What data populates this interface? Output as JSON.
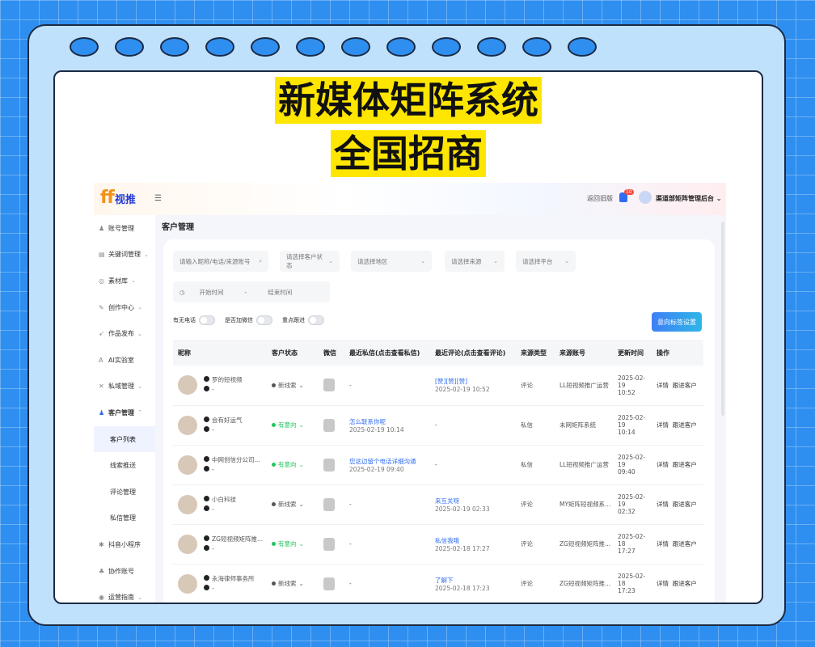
{
  "headline": {
    "line1": "新媒体矩阵系统",
    "line2": "全国招商"
  },
  "topbar": {
    "logo_main": "ff",
    "logo_sub": "视推",
    "old_version": "返回旧版",
    "badge": "10",
    "user_name": "渠道部矩阵管理后台"
  },
  "sidebar": {
    "items": [
      {
        "label": "账号管理",
        "icon": "account-icon",
        "chevron": ""
      },
      {
        "label": "关键词管理",
        "icon": "keyword-icon",
        "chevron": "⌄"
      },
      {
        "label": "素材库",
        "icon": "material-icon",
        "chevron": "⌄"
      },
      {
        "label": "创作中心",
        "icon": "create-icon",
        "chevron": "⌄"
      },
      {
        "label": "作品发布",
        "icon": "publish-icon",
        "chevron": "⌄"
      },
      {
        "label": "AI实验室",
        "icon": "ai-icon",
        "chevron": ""
      },
      {
        "label": "私域管理",
        "icon": "private-icon",
        "chevron": "⌄"
      },
      {
        "label": "客户管理",
        "icon": "customer-icon",
        "chevron": "⌃"
      },
      {
        "label": "客户列表",
        "icon": "",
        "chevron": ""
      },
      {
        "label": "线索推送",
        "icon": "",
        "chevron": ""
      },
      {
        "label": "评论管理",
        "icon": "",
        "chevron": ""
      },
      {
        "label": "私信管理",
        "icon": "",
        "chevron": ""
      },
      {
        "label": "抖音小程序",
        "icon": "miniapp-icon",
        "chevron": ""
      },
      {
        "label": "协作账号",
        "icon": "collab-icon",
        "chevron": ""
      },
      {
        "label": "运营指南",
        "icon": "guide-icon",
        "chevron": "⌄"
      }
    ]
  },
  "page_title": "客户管理",
  "filters": {
    "search_placeholder": "请输入昵称/电话/来源账号",
    "status": "请选择客户状态",
    "region": "请选择地区",
    "source": "请选择来源",
    "platform": "请选择平台",
    "start_time": "开始时间",
    "separator": "-",
    "end_time": "结束时间"
  },
  "toggles": {
    "has_phone": "有无电话",
    "has_wechat": "是否加微信",
    "key_follow": "重点跟进"
  },
  "tag_button": "意向标签设置",
  "table": {
    "headers": [
      "昵称",
      "客户状态",
      "微信",
      "最近私信(点击查看私信)",
      "最近评论(点击查看评论)",
      "来源类型",
      "来源账号",
      "更新时间",
      "操作"
    ],
    "rows": [
      {
        "nick": "罗的短视频",
        "phone": "-",
        "status": "新线索",
        "status_color": "#555555",
        "msg": "-",
        "msg_time": "",
        "comment": "[赞][赞][赞]",
        "comment_time": "2025-02-19 10:52",
        "source_type": "评论",
        "source_account": "LL短视频推广运营",
        "update_date": "2025-02-19",
        "update_time": "10:52",
        "action1": "详情",
        "action2": "跟进客户"
      },
      {
        "nick": "会有好运气",
        "phone": "-",
        "status": "有意向",
        "status_color": "#22c55e",
        "msg": "怎么联系你呢",
        "msg_time": "2025-02-19 10:14",
        "comment": "-",
        "comment_time": "",
        "source_type": "私信",
        "source_account": "未网矩阵系统",
        "update_date": "2025-02-19",
        "update_time": "10:14",
        "action1": "详情",
        "action2": "跟进客户"
      },
      {
        "nick": "中网创信分公司...",
        "phone": "-",
        "status": "有意向",
        "status_color": "#22c55e",
        "msg": "您这边留个电话详细沟通",
        "msg_time": "2025-02-19 09:40",
        "comment": "-",
        "comment_time": "",
        "source_type": "私信",
        "source_account": "LL短视频推广运营",
        "update_date": "2025-02-19",
        "update_time": "09:40",
        "action1": "详情",
        "action2": "跟进客户"
      },
      {
        "nick": "小白科技",
        "phone": "-",
        "status": "新线索",
        "status_color": "#555555",
        "msg": "-",
        "msg_time": "",
        "comment": "来互关呀",
        "comment_time": "2025-02-19 02:33",
        "source_type": "评论",
        "source_account": "MY矩阵短视频系...",
        "update_date": "2025-02-19",
        "update_time": "02:32",
        "action1": "详情",
        "action2": "跟进客户"
      },
      {
        "nick": "ZG短视频矩阵推...",
        "phone": "-",
        "status": "有意向",
        "status_color": "#22c55e",
        "msg": "-",
        "msg_time": "",
        "comment": "私信我哦",
        "comment_time": "2025-02-18 17:27",
        "source_type": "评论",
        "source_account": "ZG短视频矩阵推...",
        "update_date": "2025-02-18",
        "update_time": "17:27",
        "action1": "详情",
        "action2": "跟进客户"
      },
      {
        "nick": "永海律师事务所",
        "phone": "-",
        "status": "新线索",
        "status_color": "#555555",
        "msg": "-",
        "msg_time": "",
        "comment": "了解下",
        "comment_time": "2025-02-18 17:23",
        "source_type": "评论",
        "source_account": "ZG短视频矩阵推...",
        "update_date": "2025-02-18",
        "update_time": "17:23",
        "action1": "详情",
        "action2": "跟进客户"
      }
    ]
  },
  "colors": {
    "accent": "#2e6bf2",
    "highlight": "#ffe600",
    "background": "#2f8ff0"
  }
}
